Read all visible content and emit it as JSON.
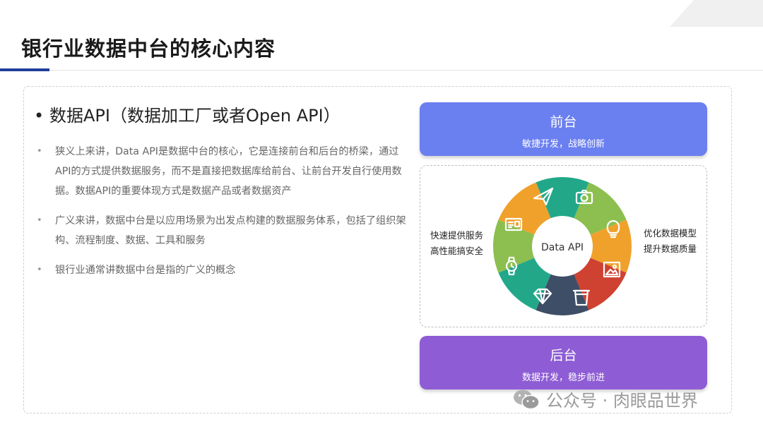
{
  "title": "银行业数据中台的核心内容",
  "heading": "数据API（数据加工厂或者Open API）",
  "bullets": [
    "狭义上来讲，Data API是数据中台的核心，它是连接前台和后台的桥梁，通过API的方式提供数据服务，而不是直接把数据库给前台、让前台开发自行使用数据。数据API的重要体现方式是数据产品或者数据资产",
    "广义来讲，数据中台是以应用场景为出发点构建的数据服务体系，包括了组织架构、流程制度、数据、工具和服务",
    "银行业通常讲数据中台是指的广义的概念"
  ],
  "front": {
    "title": "前台",
    "subtitle": "敏捷开发，战略创新",
    "color": "#6a7ff0"
  },
  "back": {
    "title": "后台",
    "subtitle": "数据开发，稳步前进",
    "color": "#8e5cd4"
  },
  "diagram": {
    "center_label": "Data API",
    "left_lines": [
      "快速提供服务",
      "高性能搞安全"
    ],
    "right_lines": [
      "优化数据模型",
      "提升数据质量"
    ],
    "segments": [
      {
        "icon": "paper-plane-icon",
        "color": "#22a889"
      },
      {
        "icon": "camera-icon",
        "color": "#8cbf4f"
      },
      {
        "icon": "lightbulb-icon",
        "color": "#f0a12b"
      },
      {
        "icon": "picture-icon",
        "color": "#cf4130"
      },
      {
        "icon": "cup-icon",
        "color": "#3e4e66"
      },
      {
        "icon": "diamond-icon",
        "color": "#22a889"
      },
      {
        "icon": "watch-icon",
        "color": "#8cbf4f"
      },
      {
        "icon": "id-card-icon",
        "color": "#f0a12b"
      }
    ]
  },
  "watermark": "公众号 · 肉眼品世界"
}
